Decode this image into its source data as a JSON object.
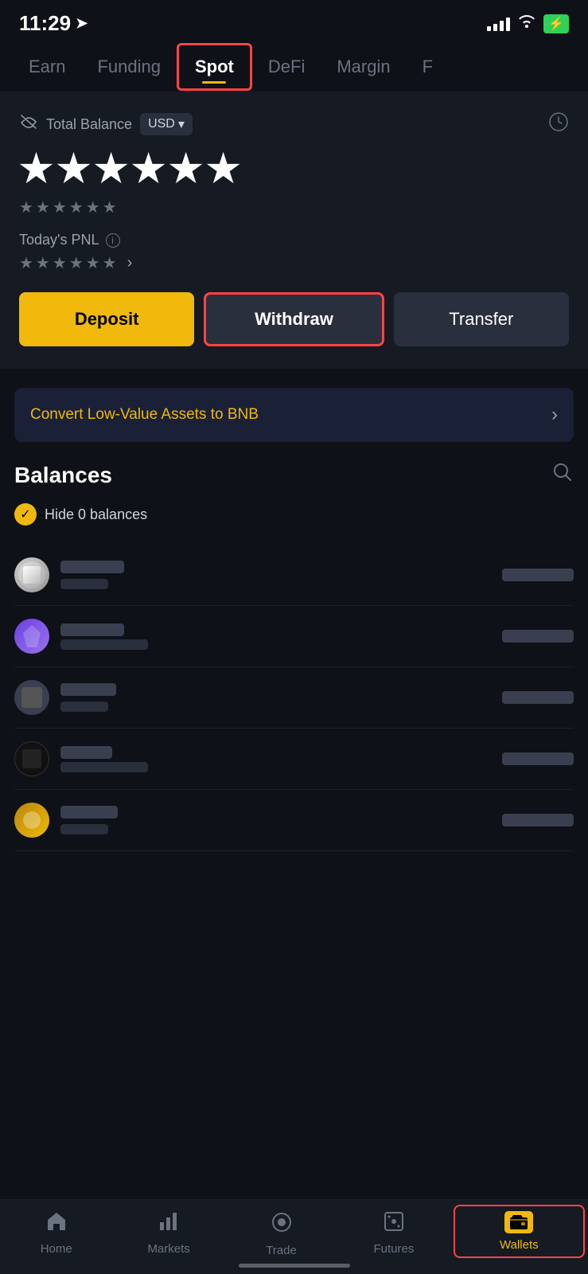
{
  "statusBar": {
    "time": "11:29",
    "locationArrow": "➤"
  },
  "tabs": [
    {
      "id": "earn",
      "label": "Earn",
      "active": false
    },
    {
      "id": "funding",
      "label": "Funding",
      "active": false
    },
    {
      "id": "spot",
      "label": "Spot",
      "active": true
    },
    {
      "id": "defi",
      "label": "DeFi",
      "active": false
    },
    {
      "id": "margin",
      "label": "Margin",
      "active": false
    },
    {
      "id": "f",
      "label": "F",
      "active": false
    }
  ],
  "balance": {
    "label": "Total Balance",
    "currency": "USD",
    "currencyArrow": "▾",
    "stars": "★★★★★★",
    "subStars": "★★★★★★",
    "pnlLabel": "Today's PNL",
    "pnlStars": "★★★★★★"
  },
  "buttons": {
    "deposit": "Deposit",
    "withdraw": "Withdraw",
    "transfer": "Transfer"
  },
  "convertBanner": {
    "text": "Convert Low-Value Assets to BNB",
    "arrow": "›"
  },
  "balancesSection": {
    "title": "Balances",
    "hideZeroLabel": "Hide 0 balances"
  },
  "bottomNav": [
    {
      "id": "home",
      "label": "Home",
      "icon": "⌂",
      "active": false
    },
    {
      "id": "markets",
      "label": "Markets",
      "icon": "▦",
      "active": false
    },
    {
      "id": "trade",
      "label": "Trade",
      "icon": "◎",
      "active": false
    },
    {
      "id": "futures",
      "label": "Futures",
      "icon": "⬛",
      "active": false
    },
    {
      "id": "wallets",
      "label": "Wallets",
      "active": true
    }
  ]
}
